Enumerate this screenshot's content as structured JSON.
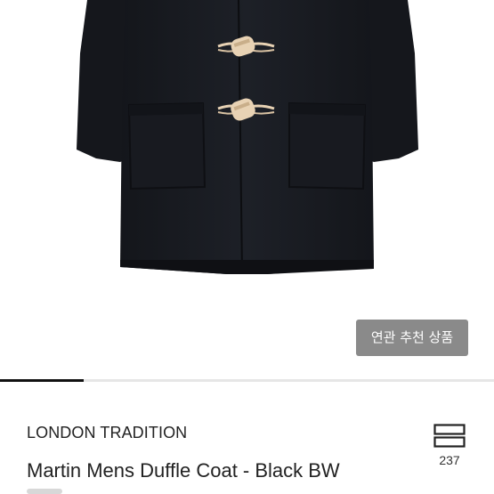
{
  "product_image": {
    "recommend_button_label": "연관 추천 상품",
    "gallery_progress": 0.17
  },
  "product": {
    "brand": "LONDON TRADITION",
    "title": "Martin Mens Duffle Coat - Black BW",
    "wish_count": "237"
  },
  "icons": {
    "wish": "bookmark-stack-icon"
  },
  "colors": {
    "accent": "#111111",
    "button_bg": "#8a8a8a",
    "coat": "#1a1c22",
    "toggle": "#e8d2b4"
  }
}
